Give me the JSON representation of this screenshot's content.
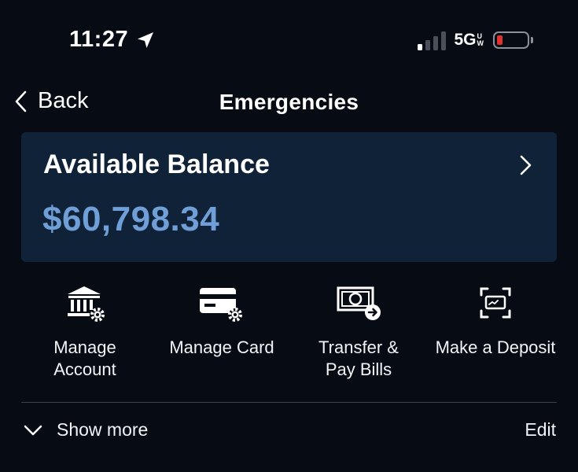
{
  "status_bar": {
    "time": "11:27",
    "network": "5G",
    "network_sub_top": "U",
    "network_sub_bottom": "W",
    "signal_bars_active": 1,
    "signal_bars_total": 4,
    "battery_level_fraction": 0.12,
    "battery_color": "#e0332f"
  },
  "nav": {
    "back_label": "Back",
    "title": "Emergencies"
  },
  "balance": {
    "label": "Available Balance",
    "amount": "$60,798.34",
    "amount_color": "#6f9fd6",
    "card_color": "#102238"
  },
  "actions": [
    {
      "label": "Manage\nAccount",
      "icon": "bank-settings-icon"
    },
    {
      "label": "Manage Card",
      "icon": "card-settings-icon"
    },
    {
      "label": "Transfer &\nPay Bills",
      "icon": "transfer-bill-icon"
    },
    {
      "label": "Make a Deposit",
      "icon": "check-scan-icon"
    }
  ],
  "footer": {
    "show_more_label": "Show more",
    "edit_label": "Edit"
  },
  "colors": {
    "background": "#060b14",
    "text": "#ffffff"
  }
}
